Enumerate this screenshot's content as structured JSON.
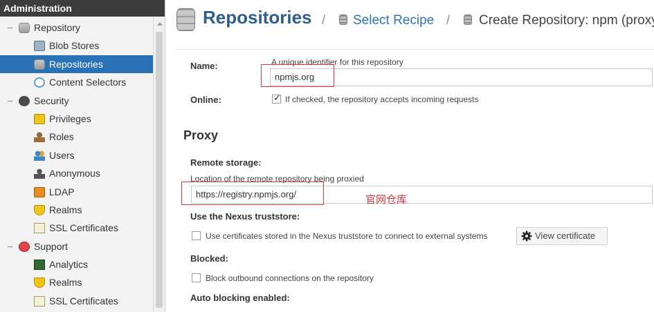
{
  "sidebar": {
    "header": "Administration",
    "items": [
      {
        "label": "Repository",
        "icon": "database-icon"
      },
      {
        "label": "Blob Stores",
        "icon": "blob-store-icon"
      },
      {
        "label": "Repositories",
        "icon": "database-icon"
      },
      {
        "label": "Content Selectors",
        "icon": "eye-icon"
      },
      {
        "label": "Security",
        "icon": "lock-icon"
      },
      {
        "label": "Privileges",
        "icon": "badge-icon"
      },
      {
        "label": "Roles",
        "icon": "user-icon"
      },
      {
        "label": "Users",
        "icon": "users-icon"
      },
      {
        "label": "Anonymous",
        "icon": "anonymous-icon"
      },
      {
        "label": "LDAP",
        "icon": "ldap-icon"
      },
      {
        "label": "Realms",
        "icon": "shield-icon"
      },
      {
        "label": "SSL Certificates",
        "icon": "certificate-icon"
      },
      {
        "label": "Support",
        "icon": "support-icon"
      },
      {
        "label": "Analytics",
        "icon": "chart-icon"
      },
      {
        "label": "Realms",
        "icon": "shield-icon"
      },
      {
        "label": "SSL Certificates",
        "icon": "certificate-icon"
      }
    ],
    "collapse_symbol": "–"
  },
  "breadcrumb": {
    "title": "Repositories",
    "separator": "/",
    "link": "Select Recipe",
    "current": "Create Repository: npm (proxy)"
  },
  "form": {
    "name": {
      "label": "Name:",
      "help": "A unique identifier for this repository",
      "value": "npmjs.org"
    },
    "online": {
      "label": "Online:",
      "checkbox_text": "If checked, the repository accepts incoming requests",
      "checked": true
    },
    "proxy_section": "Proxy",
    "remote_storage": {
      "label": "Remote storage:",
      "help": "Location of the remote repository being proxied",
      "value": "https://registry.npmjs.org/"
    },
    "annotation": "官网仓库",
    "truststore": {
      "label": "Use the Nexus truststore:",
      "checkbox_text": "Use certificates stored in the Nexus truststore to connect to external systems",
      "checked": false,
      "button": "View certificate"
    },
    "blocked": {
      "label": "Blocked:",
      "checkbox_text": "Block outbound connections on the repository",
      "checked": false
    },
    "auto_blocking": {
      "label": "Auto blocking enabled:"
    }
  },
  "colors": {
    "accent": "#2a72b5",
    "title": "#2f5d8c",
    "link": "#2f73b3",
    "annotation": "#d9363e",
    "sidebar_header": "#3d3d3d"
  }
}
